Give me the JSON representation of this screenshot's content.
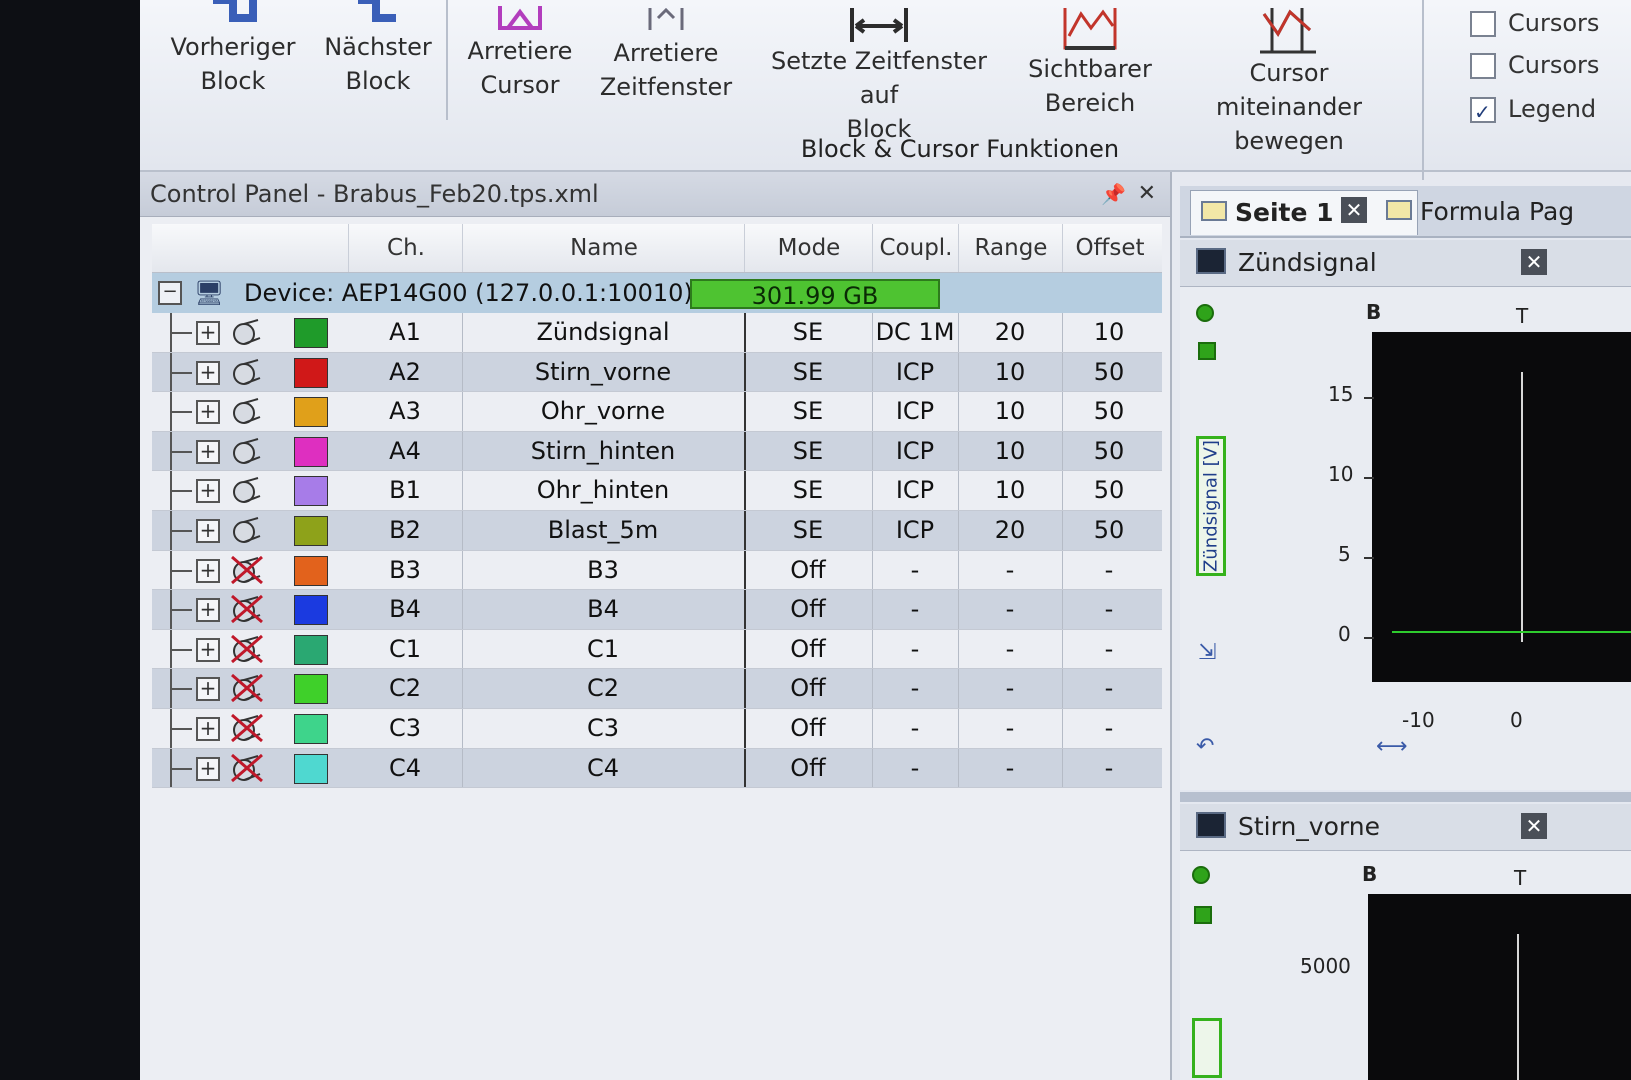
{
  "ribbon": {
    "buttons": [
      {
        "label": "Vorheriger\nBlock"
      },
      {
        "label": "Nächster\nBlock"
      },
      {
        "label": "Arretiere\nCursor"
      },
      {
        "label": "Arretiere\nZeitfenster"
      },
      {
        "label": "Setzte Zeitfenster auf\nBlock"
      },
      {
        "label": "Sichtbarer\nBereich"
      },
      {
        "label": "Cursor miteinander\nbewegen"
      }
    ],
    "group_label": "Block & Cursor Funktionen",
    "checkboxes": [
      {
        "label": "Cursors",
        "checked": false
      },
      {
        "label": "Cursors",
        "checked": false
      },
      {
        "label": "Legend",
        "checked": true
      }
    ]
  },
  "control_panel": {
    "title": "Control Panel - Brabus_Feb20.tps.xml",
    "headers": {
      "ch": "Ch.",
      "name": "Name",
      "mode": "Mode",
      "coupl": "Coupl.",
      "range": "Range",
      "offset": "Offset"
    },
    "device": {
      "label": "Device: AEP14G00  (127.0.0.1:10010)",
      "storage": "301.99 GB"
    },
    "channels": [
      {
        "ch": "A1",
        "name": "Zündsignal",
        "mode": "SE",
        "coupl": "DC 1M",
        "range": "20",
        "offset": "10",
        "color": "#1f9b2a",
        "active": true
      },
      {
        "ch": "A2",
        "name": "Stirn_vorne",
        "mode": "SE",
        "coupl": "ICP",
        "range": "10",
        "offset": "50",
        "color": "#d01818",
        "active": true
      },
      {
        "ch": "A3",
        "name": "Ohr_vorne",
        "mode": "SE",
        "coupl": "ICP",
        "range": "10",
        "offset": "50",
        "color": "#e0a01a",
        "active": true
      },
      {
        "ch": "A4",
        "name": "Stirn_hinten",
        "mode": "SE",
        "coupl": "ICP",
        "range": "10",
        "offset": "50",
        "color": "#de2fc0",
        "active": true
      },
      {
        "ch": "B1",
        "name": "Ohr_hinten",
        "mode": "SE",
        "coupl": "ICP",
        "range": "10",
        "offset": "50",
        "color": "#a77ce8",
        "active": true
      },
      {
        "ch": "B2",
        "name": "Blast_5m",
        "mode": "SE",
        "coupl": "ICP",
        "range": "20",
        "offset": "50",
        "color": "#8ea21a",
        "active": true
      },
      {
        "ch": "B3",
        "name": "B3",
        "mode": "Off",
        "coupl": "-",
        "range": "-",
        "offset": "-",
        "color": "#e2621c",
        "active": false
      },
      {
        "ch": "B4",
        "name": "B4",
        "mode": "Off",
        "coupl": "-",
        "range": "-",
        "offset": "-",
        "color": "#1b3ae0",
        "active": false
      },
      {
        "ch": "C1",
        "name": "C1",
        "mode": "Off",
        "coupl": "-",
        "range": "-",
        "offset": "-",
        "color": "#2aa872",
        "active": false
      },
      {
        "ch": "C2",
        "name": "C2",
        "mode": "Off",
        "coupl": "-",
        "range": "-",
        "offset": "-",
        "color": "#3fd02a",
        "active": false
      },
      {
        "ch": "C3",
        "name": "C3",
        "mode": "Off",
        "coupl": "-",
        "range": "-",
        "offset": "-",
        "color": "#3ed48b",
        "active": false
      },
      {
        "ch": "C4",
        "name": "C4",
        "mode": "Off",
        "coupl": "-",
        "range": "-",
        "offset": "-",
        "color": "#4fd8d0",
        "active": false
      }
    ]
  },
  "right_panel": {
    "tabs": [
      {
        "label": "Seite 1"
      },
      {
        "label": "Formula Pag"
      }
    ],
    "chart1": {
      "title": "Zündsignal",
      "ylabel": "Zündsignal [V]",
      "marker_b": "B",
      "marker_t": "T",
      "yticks": [
        "15",
        "10",
        "5",
        "0"
      ],
      "xticks": [
        "-10",
        "0"
      ]
    },
    "chart2": {
      "title": "Stirn_vorne",
      "marker_b": "B",
      "marker_t": "T",
      "yticks": [
        "5000"
      ]
    }
  }
}
